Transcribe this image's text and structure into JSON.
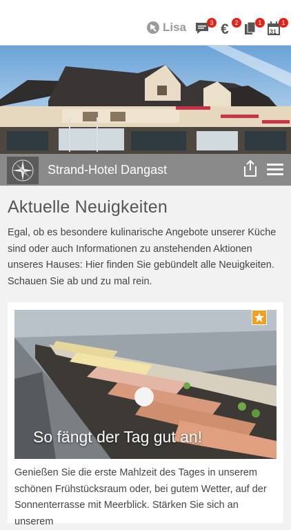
{
  "header": {
    "user_name": "Lisa",
    "icons": [
      {
        "name": "chat-icon",
        "badge": "3"
      },
      {
        "name": "euro-icon",
        "badge": "2"
      },
      {
        "name": "documents-icon",
        "badge": "1"
      },
      {
        "name": "calendar-icon",
        "badge": "1",
        "day": "31"
      }
    ]
  },
  "hotel": {
    "name": "Strand-Hotel Dangast"
  },
  "main": {
    "title": "Aktuelle Neuigkeiten",
    "intro": "Egal, ob es besondere kulinarische Angebote unserer Küche sind oder auch Informationen zu anstehenden Aktionen unseres Hauses: Hier finden Sie gebündelt alle Neuigkeiten. Schauen Sie ab und zu mal rein."
  },
  "news": [
    {
      "title": "So fängt der Tag gut an!",
      "text": "Genießen Sie die erste Mahlzeit des Tages in unserem schönen Frühstücksraum oder, bei gutem Wetter, auf der Sonnenterrasse mit Meerblick. Stärken Sie sich an unserem"
    }
  ],
  "colors": {
    "badge": "#e2231a",
    "titlebar": "#8a8a8a",
    "star": "#f0a020"
  }
}
